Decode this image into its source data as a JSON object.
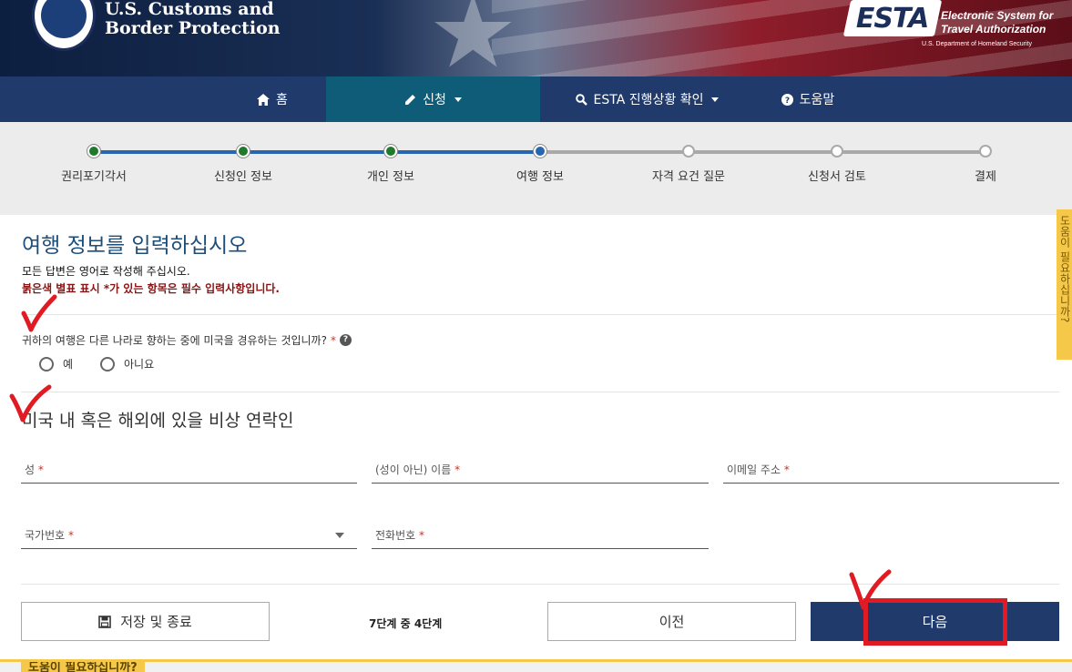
{
  "header": {
    "agency_line1": "U.S. Customs and",
    "agency_line2": "Border Protection",
    "esta_logo": "ESTA",
    "esta_line1": "Electronic System for",
    "esta_line2": "Travel Authorization",
    "dept": "U.S. Department of Homeland Security"
  },
  "nav": {
    "home": "홈",
    "apply": "신청",
    "status": "ESTA 진행상황 확인",
    "help": "도움말"
  },
  "steps": [
    {
      "label": "권리포기각서",
      "state": "done"
    },
    {
      "label": "신청인 정보",
      "state": "done"
    },
    {
      "label": "개인 정보",
      "state": "done"
    },
    {
      "label": "여행 정보",
      "state": "current"
    },
    {
      "label": "자격 요건 질문",
      "state": "todo"
    },
    {
      "label": "신청서 검토",
      "state": "todo"
    },
    {
      "label": "결제",
      "state": "todo"
    }
  ],
  "page": {
    "title": "여행 정보를 입력하십시오",
    "note_english": "모든 답변은 영어로 작성해 주십시오.",
    "note_required": "붉은색 별표 표시 *가 있는 항목은 필수 입력사항입니다.",
    "transit_question": "귀하의 여행은 다른 나라로 향하는 중에 미국을 경유하는 것입니까?",
    "required_mark": "*",
    "option_yes": "예",
    "option_no": "아니요",
    "emergency_title": "미국 내 혹은 해외에 있을 비상 연락인"
  },
  "fields": {
    "last_name": "성",
    "first_name": "(성이 아닌) 이름",
    "email": "이메일 주소",
    "country_code": "국가번호",
    "phone": "전화번호"
  },
  "footer": {
    "save_label": "저장 및 종료",
    "step_count": "7단계 중 4단계",
    "prev_label": "이전",
    "next_label": "다음",
    "help_prompt": "도움이 필요하십니까?"
  },
  "side_tab": {
    "label": "도움이 필요하십니까?"
  },
  "colors": {
    "nav": "#203a6b",
    "nav_active": "#0e5c78",
    "done": "#1f7a2c",
    "current": "#2966b0",
    "required": "#8a1414",
    "annotation": "#e01b24",
    "help": "#f6c84a"
  }
}
